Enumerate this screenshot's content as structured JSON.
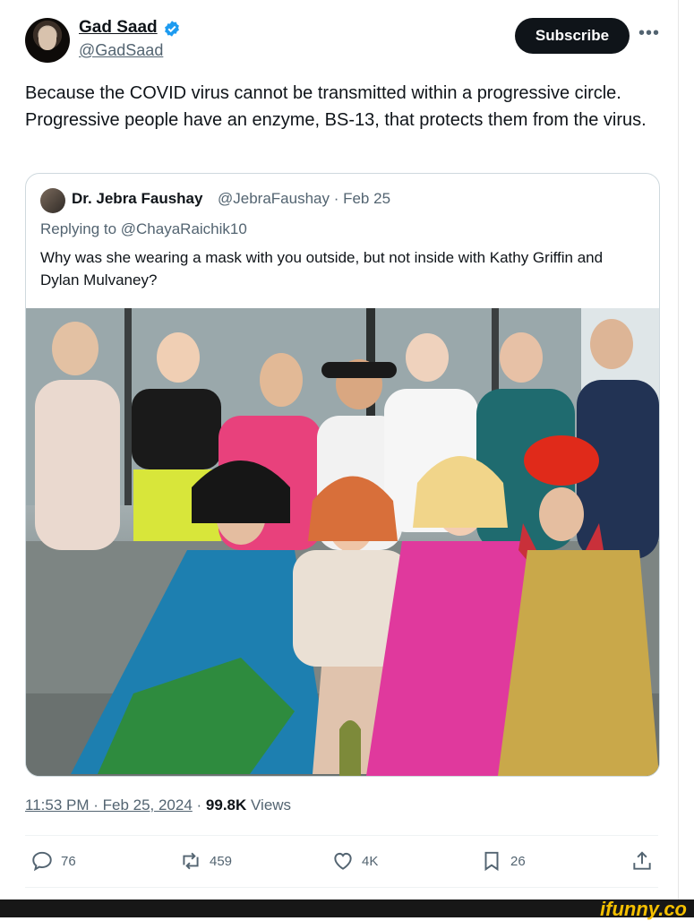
{
  "author": {
    "name": "Gad Saad",
    "handle": "@GadSaad",
    "subscribe_label": "Subscribe"
  },
  "tweet": {
    "text": "Because the COVID virus cannot be transmitted within a progressive circle. Progressive people have an enzyme, BS-13, that protects them from the virus."
  },
  "quote": {
    "name": "Dr. Jebra Faushay",
    "handle_date": "@JebraFaushay · Feb 25",
    "replying": "Replying to @ChayaRaichik10",
    "text": "Why was she wearing a mask with you outside, but not inside with Kathy Griffin and Dylan Mulvaney?"
  },
  "meta": {
    "time": "11:53 PM · Feb 25, 2024",
    "sep": " · ",
    "views_count": "99.8K",
    "views_label": " Views"
  },
  "actions": {
    "replies": "76",
    "reposts": "459",
    "likes": "4K",
    "bookmarks": "26"
  },
  "watermark": "ifunny.co",
  "colors": {
    "accent": "#1d9bf0",
    "text": "#0f1419",
    "muted": "#536471"
  }
}
